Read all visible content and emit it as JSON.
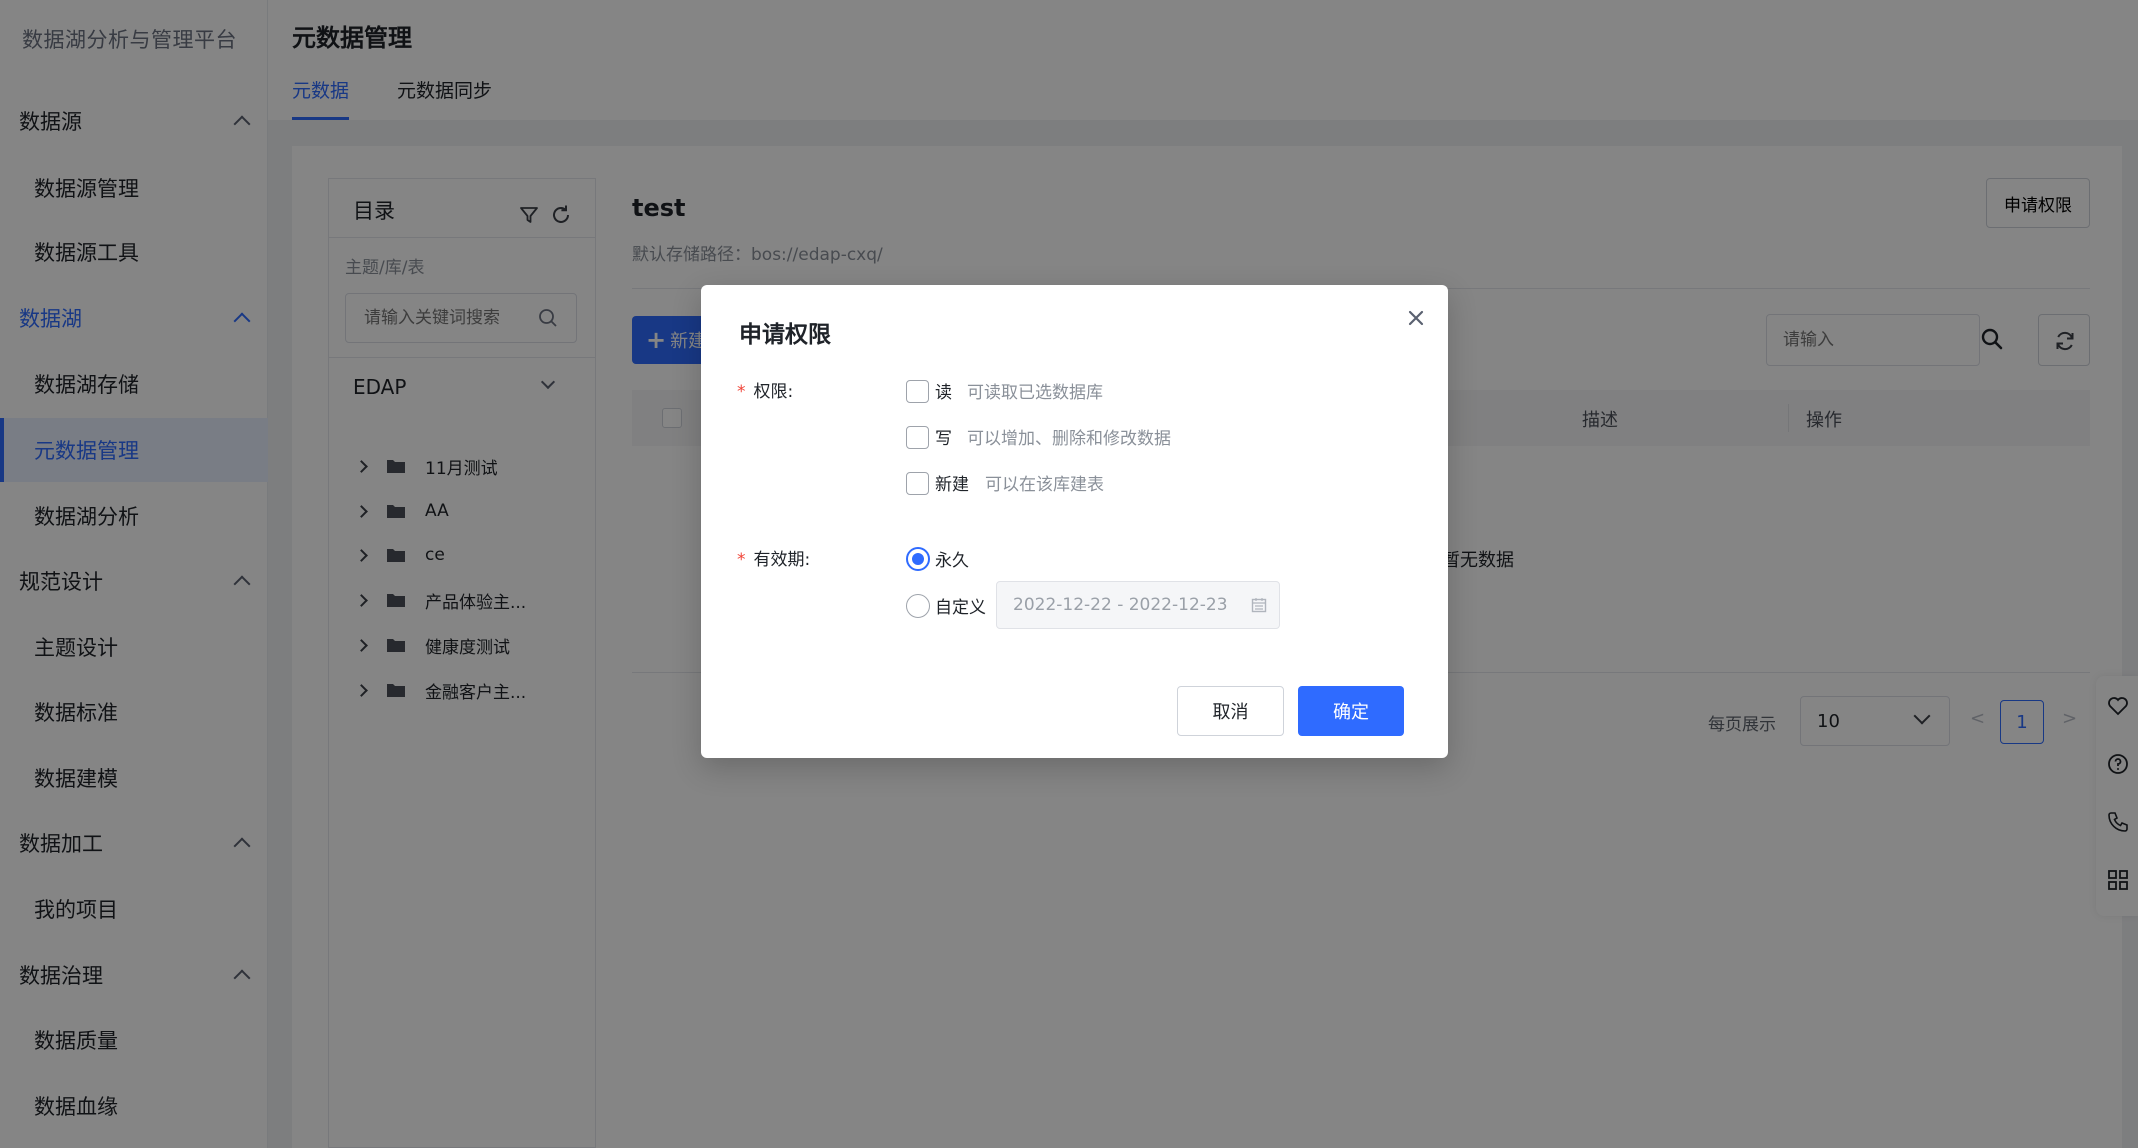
{
  "app": {
    "title": "数据湖分析与管理平台"
  },
  "colors": {
    "accent": "#2f6bff",
    "required": "#f04438"
  },
  "sidebar": {
    "groups": [
      {
        "label": "数据源",
        "items": [
          "数据源管理",
          "数据源工具"
        ]
      },
      {
        "label": "数据湖",
        "items": [
          "数据湖存储",
          "元数据管理",
          "数据湖分析"
        ],
        "active": true
      },
      {
        "label": "规范设计",
        "items": [
          "主题设计",
          "数据标准",
          "数据建模"
        ]
      },
      {
        "label": "数据加工",
        "items": [
          "我的项目"
        ]
      },
      {
        "label": "数据治理",
        "items": [
          "数据质量",
          "数据血缘"
        ]
      }
    ],
    "selected_item": "元数据管理"
  },
  "header": {
    "title": "元数据管理",
    "tabs": [
      {
        "label": "元数据",
        "active": true
      },
      {
        "label": "元数据同步",
        "active": false
      }
    ]
  },
  "directory": {
    "title": "目录",
    "subtitle": "主题/库/表",
    "search_placeholder": "请输入关键词搜索",
    "root": "EDAP",
    "items": [
      "11月测试",
      "AA",
      "ce",
      "产品体验主...",
      "健康度测试",
      "金融客户主..."
    ]
  },
  "main": {
    "db_name": "test",
    "storage_path": "默认存储路径：bos://edap-cxq/",
    "apply_button": "申请权限",
    "new_button": "新建",
    "search_placeholder": "请输入",
    "table_headers": {
      "description": "描述",
      "operation": "操作"
    },
    "empty_text": "暂无数据",
    "pager": {
      "label": "每页展示",
      "page_size": "10",
      "current_page": "1",
      "prev": "<",
      "next": ">"
    }
  },
  "dialog": {
    "title": "申请权限",
    "permission_label": "权限:",
    "permissions": [
      {
        "name": "读",
        "desc": "可读取已选数据库",
        "checked": false
      },
      {
        "name": "写",
        "desc": "可以增加、删除和修改数据",
        "checked": false
      },
      {
        "name": "新建",
        "desc": "可以在该库建表",
        "checked": false
      }
    ],
    "validity_label": "有效期:",
    "validity_options": [
      {
        "name": "永久",
        "checked": true
      },
      {
        "name": "自定义",
        "checked": false
      }
    ],
    "date_range": "2022-12-22 - 2022-12-23",
    "cancel": "取消",
    "confirm": "确定"
  }
}
